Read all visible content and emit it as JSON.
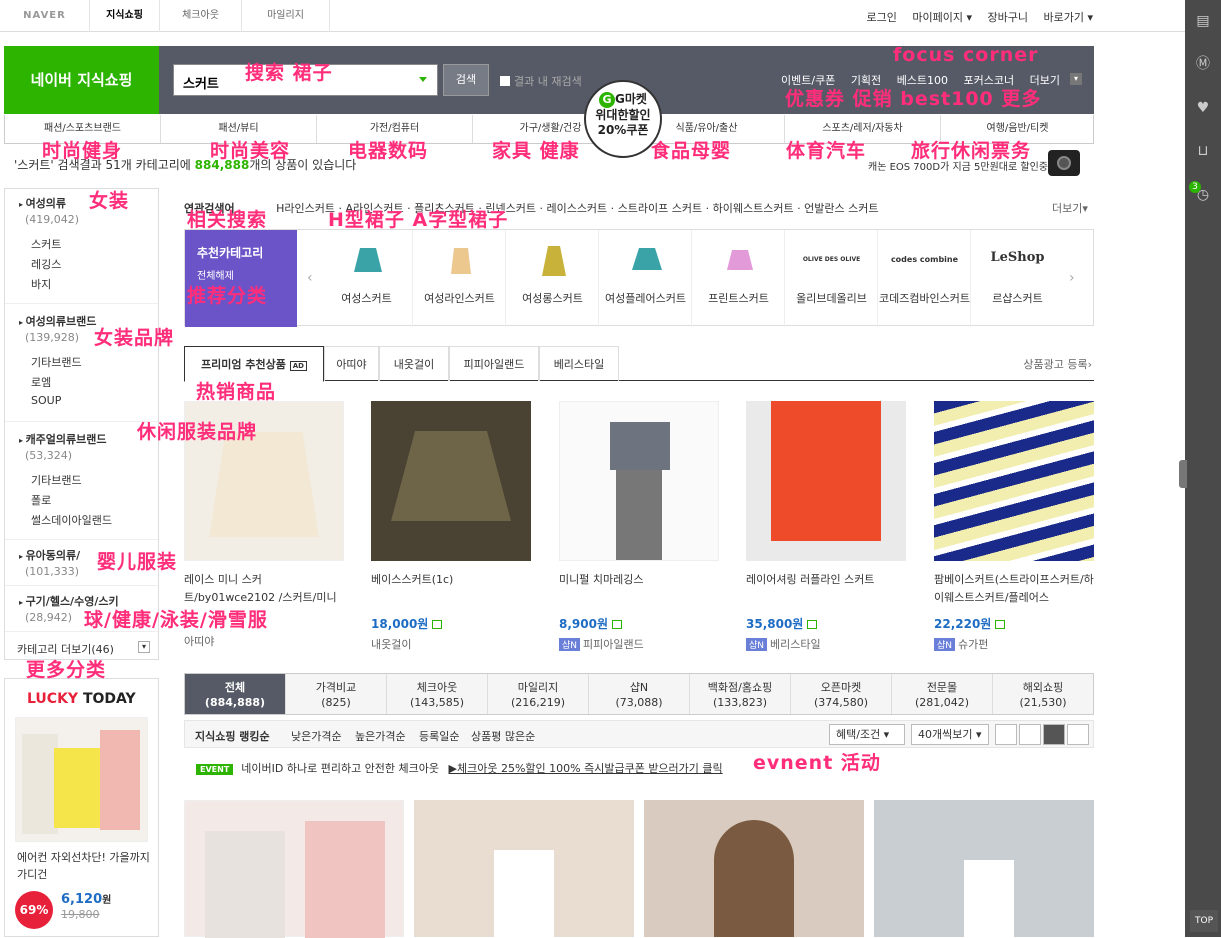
{
  "top": {
    "logo": "NAVER",
    "tabs": [
      "지식쇼핑",
      "체크아웃",
      "마일리지"
    ],
    "links": [
      "로그인",
      "마이페이지 ▾",
      "장바구니",
      "바로가기 ▾"
    ]
  },
  "search": {
    "brand": "네이버 지식쇼핑",
    "query": "스커트",
    "button": "검색",
    "within": "결과 내 재검색",
    "promo_links": [
      "이벤트/쿠폰",
      "기획전",
      "베스트100",
      "포커스코너",
      "더보기"
    ]
  },
  "gmarket_badge": {
    "top": "G마켓",
    "line1": "위대한할인",
    "line2": "20%쿠폰"
  },
  "categories": [
    "패션/스포츠브랜드",
    "패션/뷰티",
    "가전/컴퓨터",
    "가구/생활/건강",
    "식품/유아/출산",
    "스포츠/레저/자동차",
    "여행/음반/티켓"
  ],
  "summary": {
    "prefix": "'스커트' 검색결과 51개 카테고리에",
    "count": "884,888",
    "suffix": "개의 상품이 있습니다",
    "ad": "캐논 EOS 700D가 지금 5만원대로 할인중?"
  },
  "sidebar": {
    "groups": [
      {
        "name": "여성의류",
        "count": "(419,042)",
        "items": [
          "스커트",
          "레깅스",
          "바지"
        ]
      },
      {
        "name": "여성의류브랜드",
        "count": "(139,928)",
        "items": [
          "기타브랜드",
          "로엠",
          "SOUP"
        ]
      },
      {
        "name": "캐주얼의류브랜드",
        "count": "(53,324)",
        "items": [
          "기타브랜드",
          "폴로",
          "썰스데이아일랜드"
        ]
      },
      {
        "name": "유아동의류/",
        "count": "(101,333)",
        "items": []
      },
      {
        "name": "구기/헬스/수영/스키",
        "count": "(28,942)",
        "items": []
      }
    ],
    "more": "카테고리 더보기(46)"
  },
  "lucky": {
    "title_a": "LUCKY",
    "title_b": "TODAY",
    "desc": "에어컨 자외선차단! 가을까지 가디건",
    "discount": "69%",
    "price": "6,120",
    "won": "원",
    "orig": "19,800"
  },
  "related": {
    "label": "연관검색어",
    "items": [
      "H라인스커트",
      "A라인스커트",
      "플리츠스커트",
      "린넨스커트",
      "레이스스커트",
      "스트라이프 스커트",
      "하이웨스트스커트",
      "언발란스 스커트"
    ],
    "more": "더보기▾"
  },
  "recommend": {
    "title": "추천카테고리",
    "sub": "전체해제",
    "items": [
      "여성스커트",
      "여성라인스커트",
      "여성롱스커트",
      "여성플레어스커트",
      "프린트스커트",
      "올리브데올리브",
      "코데즈컴바인스커트",
      "르샵스커트"
    ],
    "brand_logos": [
      "OLIVE DES OLIVE",
      "codes combine",
      "LeShop"
    ]
  },
  "premium_tabs": {
    "items": [
      "프리미엄 추천상품",
      "아띠야",
      "내옷걸이",
      "피피아일랜드",
      "베리스타일"
    ],
    "ad_badge": "AD",
    "right": "상품광고 등록›"
  },
  "products": [
    {
      "name": "레이스 미니 스커트/by01wce2102 /스커트/미니스커트",
      "price": "",
      "shop": "아띠야"
    },
    {
      "name": "베이스스커트(1c)",
      "price": "18,000원",
      "shop": "내옷걸이"
    },
    {
      "name": "미니펄 치마레깅스",
      "price": "8,900원",
      "shop": "피피아일랜드",
      "badge": "샵N"
    },
    {
      "name": "레이어셔링 러플라인 스커트",
      "price": "35,800원",
      "shop": "베리스타일",
      "badge": "샵N"
    },
    {
      "name": "팜베이스커트(스트라이프스커트/하이웨스트스커트/플레어스",
      "price": "22,220원",
      "shop": "슈가펀",
      "badge": "샵N"
    }
  ],
  "result_tabs": [
    {
      "label": "전체",
      "count": "(884,888)"
    },
    {
      "label": "가격비교",
      "count": "(825)"
    },
    {
      "label": "체크아웃",
      "count": "(143,585)"
    },
    {
      "label": "마일리지",
      "count": "(216,219)"
    },
    {
      "label": "샵N",
      "count": "(73,088)"
    },
    {
      "label": "백화점/홈쇼핑",
      "count": "(133,823)"
    },
    {
      "label": "오픈마켓",
      "count": "(374,580)"
    },
    {
      "label": "전문몰",
      "count": "(281,042)"
    },
    {
      "label": "해외쇼핑",
      "count": "(21,530)"
    }
  ],
  "sort": {
    "items": [
      "지식쇼핑 랭킹순",
      "낮은가격순",
      "높은가격순",
      "등록일순",
      "상품평 많은순"
    ],
    "filter": "혜택/조건",
    "per_page": "40개씩보기"
  },
  "event": {
    "badge": "EVENT",
    "text": "네이버ID 하나로 편리하고 안전한 체크아웃",
    "link": "▶체크아웃 25%할인 100% 즉시발급쿠폰 받으러가기 클릭"
  },
  "annotations": {
    "search": "搜索 裙子",
    "focus": "focus corner",
    "promo": "优惠券 促销 best100 更多",
    "fashion": "时尚健身",
    "beauty": "时尚美容",
    "digital": "电器数码",
    "home": "家具 健康",
    "food": "食品母婴",
    "sport": "体育汽车",
    "travel": "旅行休闲票务",
    "women": "女装",
    "related": "相关搜索",
    "hskirt": "H型裙子 A字型裙子",
    "reccat": "推荐分类",
    "brand": "女装品牌",
    "hot": "热销商品",
    "casual": "休闲服装品牌",
    "baby": "婴儿服装",
    "sportcat": "球/健康/泳装/滑雪服",
    "morecat": "更多分类",
    "event": "evnent 活动"
  },
  "side_badge": "3",
  "top_btn": "TOP",
  "colors": {
    "naver_green": "#2db400",
    "search_bar": "#555a66",
    "annotation": "#ff2d7a",
    "price_blue": "#1e6cc4"
  }
}
